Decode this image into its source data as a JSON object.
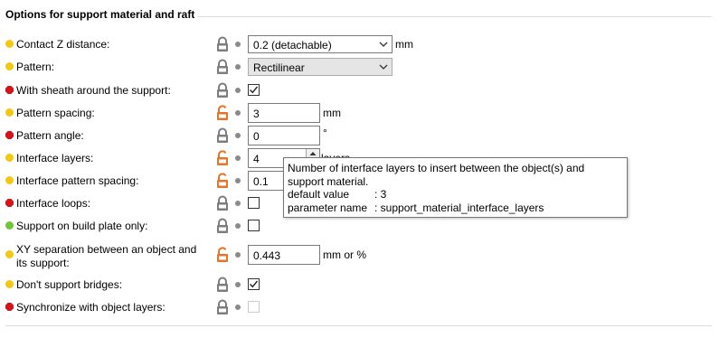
{
  "section": {
    "title": "Options for support material and raft"
  },
  "rows": [
    {
      "label": "Contact Z distance:",
      "value": "0.2 (detachable)",
      "unit": "mm"
    },
    {
      "label": "Pattern:",
      "value": "Rectilinear"
    },
    {
      "label": "With sheath around the support:"
    },
    {
      "label": "Pattern spacing:",
      "value": "3",
      "unit": "mm"
    },
    {
      "label": "Pattern angle:",
      "value": "0",
      "unit": "°"
    },
    {
      "label": "Interface layers:",
      "value": "4",
      "unit": "layers"
    },
    {
      "label": "Interface pattern spacing:",
      "value": "0.1"
    },
    {
      "label": "Interface loops:"
    },
    {
      "label": "Support on build plate only:"
    },
    {
      "label": "XY separation between an object and its support:",
      "value": "0.443",
      "unit": "mm or %"
    },
    {
      "label": "Don't support bridges:"
    },
    {
      "label": "Synchronize with object layers:"
    }
  ],
  "tooltip": {
    "description": "Number of interface layers to insert between the object(s) and support material.",
    "default_key": "default value",
    "default_value": ": 3",
    "param_key": "parameter name",
    "param_value": ": support_material_interface_layers"
  },
  "colors": {
    "yellow_dot": "#f2c811",
    "red_dot": "#d4141a",
    "green_dot": "#72c43a",
    "lock_unmodified": "#7d7d7d",
    "lock_modified": "#e3762b"
  },
  "icons": {
    "lock_closed": "lock-closed-icon",
    "lock_open": "lock-open-icon",
    "bullet": "bullet-icon",
    "dropdown": "chevron-down-icon",
    "check": "checkmark-icon"
  }
}
